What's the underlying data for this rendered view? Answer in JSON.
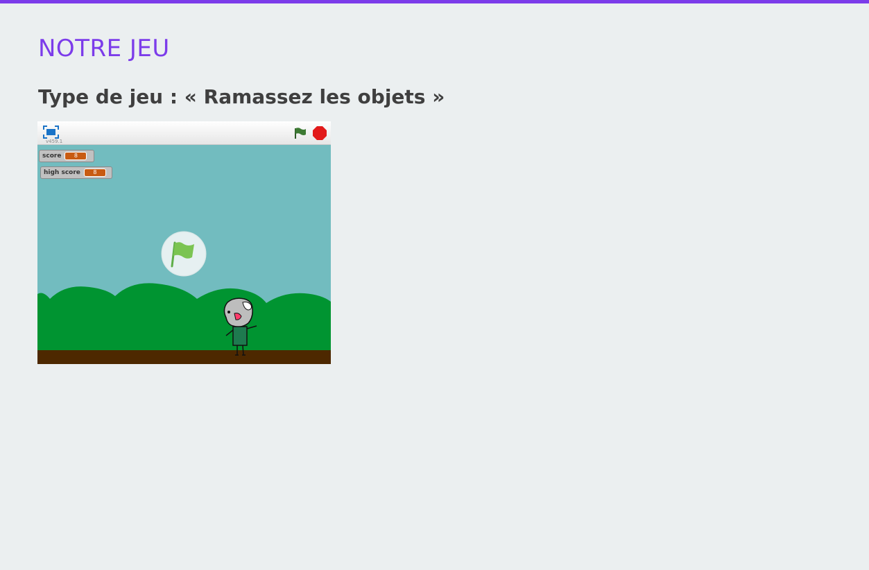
{
  "page": {
    "title": "NOTRE JEU",
    "game_type": "Type de jeu : « Ramassez les objets »"
  },
  "player": {
    "version": "v459.1",
    "monitors": {
      "score": {
        "label": "score",
        "value": "8"
      },
      "high_score": {
        "label": "high score",
        "value": "8"
      }
    },
    "icons": {
      "fullscreen": "fullscreen-icon",
      "green_flag": "green-flag-icon",
      "stop": "stop-icon",
      "start_overlay": "green-flag-start-icon"
    }
  },
  "colors": {
    "accent": "#7c3cea",
    "heading": "#3f3f3f",
    "sky": "#72bcbf",
    "hills": "#009431",
    "ground": "#4d2800",
    "monitor_value": "#c85b12"
  }
}
